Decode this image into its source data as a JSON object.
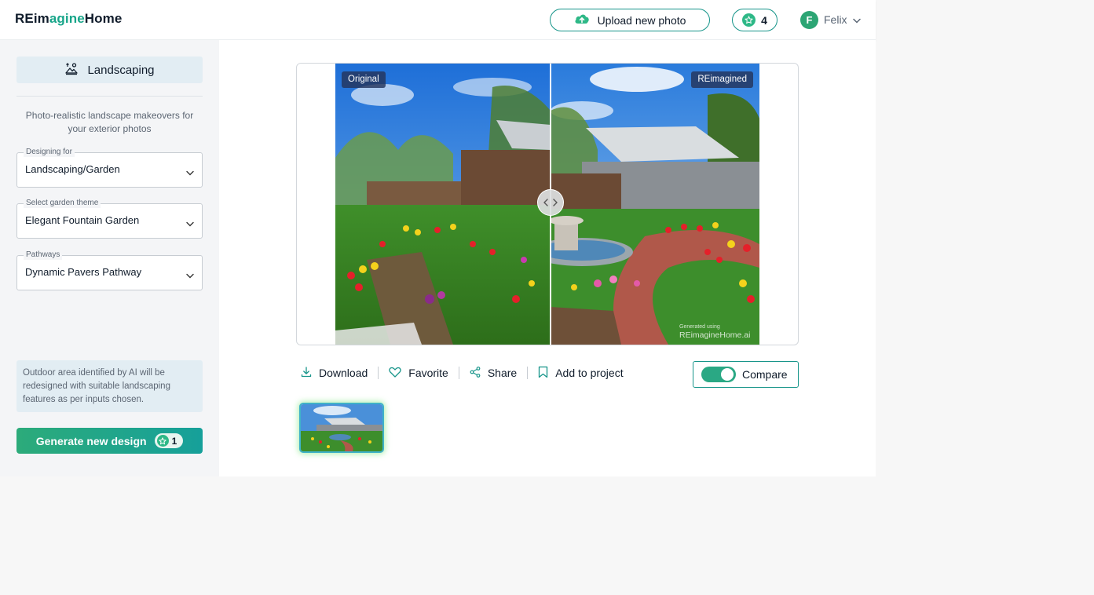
{
  "header": {
    "logo_prefix": "REim",
    "logo_accent": "agine",
    "logo_suffix": "Home",
    "upload_label": "Upload new photo",
    "credits": "4",
    "user_initial": "F",
    "user_name": "Felix"
  },
  "sidebar": {
    "mode_title": "Landscaping",
    "tagline": "Photo-realistic landscape makeovers for your exterior photos",
    "fields": [
      {
        "label": "Designing for",
        "value": "Landscaping/Garden"
      },
      {
        "label": "Select garden theme",
        "value": "Elegant Fountain Garden"
      },
      {
        "label": "Pathways",
        "value": "Dynamic Pavers Pathway"
      }
    ],
    "info": "Outdoor area identified by AI will be redesigned with suitable landscaping features as per inputs chosen.",
    "generate_label": "Generate new design",
    "generate_cost": "1"
  },
  "viewer": {
    "original_tag": "Original",
    "reimagined_tag": "REimagined",
    "watermark_small": "Generated using",
    "watermark_big": "REimagineHome.ai"
  },
  "actions": {
    "download": "Download",
    "favorite": "Favorite",
    "share": "Share",
    "add_to_project": "Add to project",
    "compare": "Compare",
    "compare_on": true
  },
  "colors": {
    "accent": "#17958a",
    "brand_green": "#2cab7a",
    "panel_blue": "#e2edf3"
  }
}
